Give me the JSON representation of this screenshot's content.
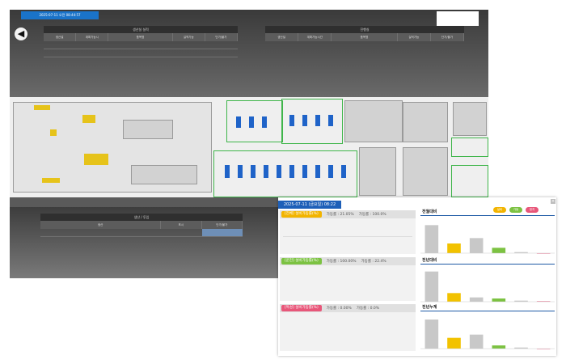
{
  "dashboard": {
    "datetime": "2025-07-11 오전 08:44:57",
    "logo_glyph": "◀",
    "panel_left": {
      "title": "생산실 실적",
      "columns": [
        "생산설",
        "계획가능시",
        "품목명",
        "실적가능",
        "단가/불가"
      ],
      "rows": [
        [
          "",
          "",
          "",
          "",
          ""
        ],
        [
          "",
          "",
          "",
          "",
          ""
        ]
      ]
    },
    "panel_right": {
      "title": "진행실",
      "columns": [
        "생산설",
        "계획가능시간",
        "품목명",
        "실적가능",
        "단가/불가"
      ]
    },
    "panel_bottom": {
      "title": "생산 / 투입",
      "columns": [
        "생산",
        "포시",
        "단가/불가"
      ]
    }
  },
  "popup": {
    "date": "2025-07-11 (금요일) 08:22",
    "close_glyph": "×",
    "legend_pills": [
      {
        "label": "설비",
        "color": "#f2b400"
      },
      {
        "label": "가동",
        "color": "#7cc242"
      },
      {
        "label": "정지",
        "color": "#e8577a"
      }
    ],
    "sections": [
      {
        "badge": "[전체] 설비가동률(%)",
        "badge_color": "#f2b400",
        "rate1": "가동률 : 21.05%",
        "rate2": "가동률 : 100.0%"
      },
      {
        "badge": "[운전] 설비가동률(%)",
        "badge_color": "#7cc242",
        "rate1": "가동률 : 100.00%",
        "rate2": "가동률 : 22.4%"
      },
      {
        "badge": "[특성] 설비가동률(%)",
        "badge_color": "#e8577a",
        "rate1": "가동률 : 0.00%",
        "rate2": "가동률 : 0.0%"
      }
    ],
    "charts": [
      {
        "title": "전월대비"
      },
      {
        "title": "전년대비"
      },
      {
        "title": "전년누계"
      }
    ]
  },
  "chart_data": [
    {
      "type": "bar",
      "title": "전월대비",
      "series": [
        {
          "name": "",
          "values": [
            2.6,
            0.9,
            1.4,
            0.5,
            0.1,
            0.0
          ]
        }
      ],
      "colors": [
        "#c8c8c8",
        "#f2c200",
        "#c8c8c8",
        "#7cc242",
        "#c8c8c8",
        "#e8577a"
      ],
      "ylim": [
        0,
        3
      ]
    },
    {
      "type": "bar",
      "title": "전년대비",
      "series": [
        {
          "name": "",
          "values": [
            2.8,
            0.8,
            0.4,
            0.3,
            0.1,
            0.05
          ]
        }
      ],
      "colors": [
        "#c8c8c8",
        "#f2c200",
        "#c8c8c8",
        "#7cc242",
        "#c8c8c8",
        "#e8577a"
      ],
      "ylim": [
        0,
        3
      ]
    },
    {
      "type": "bar",
      "title": "전년누계",
      "series": [
        {
          "name": "",
          "values": [
            2.7,
            1.0,
            1.3,
            0.3,
            0.1,
            0.0
          ]
        }
      ],
      "colors": [
        "#c8c8c8",
        "#f2c200",
        "#c8c8c8",
        "#7cc242",
        "#c8c8c8",
        "#e8577a"
      ],
      "ylim": [
        0,
        3
      ]
    }
  ]
}
